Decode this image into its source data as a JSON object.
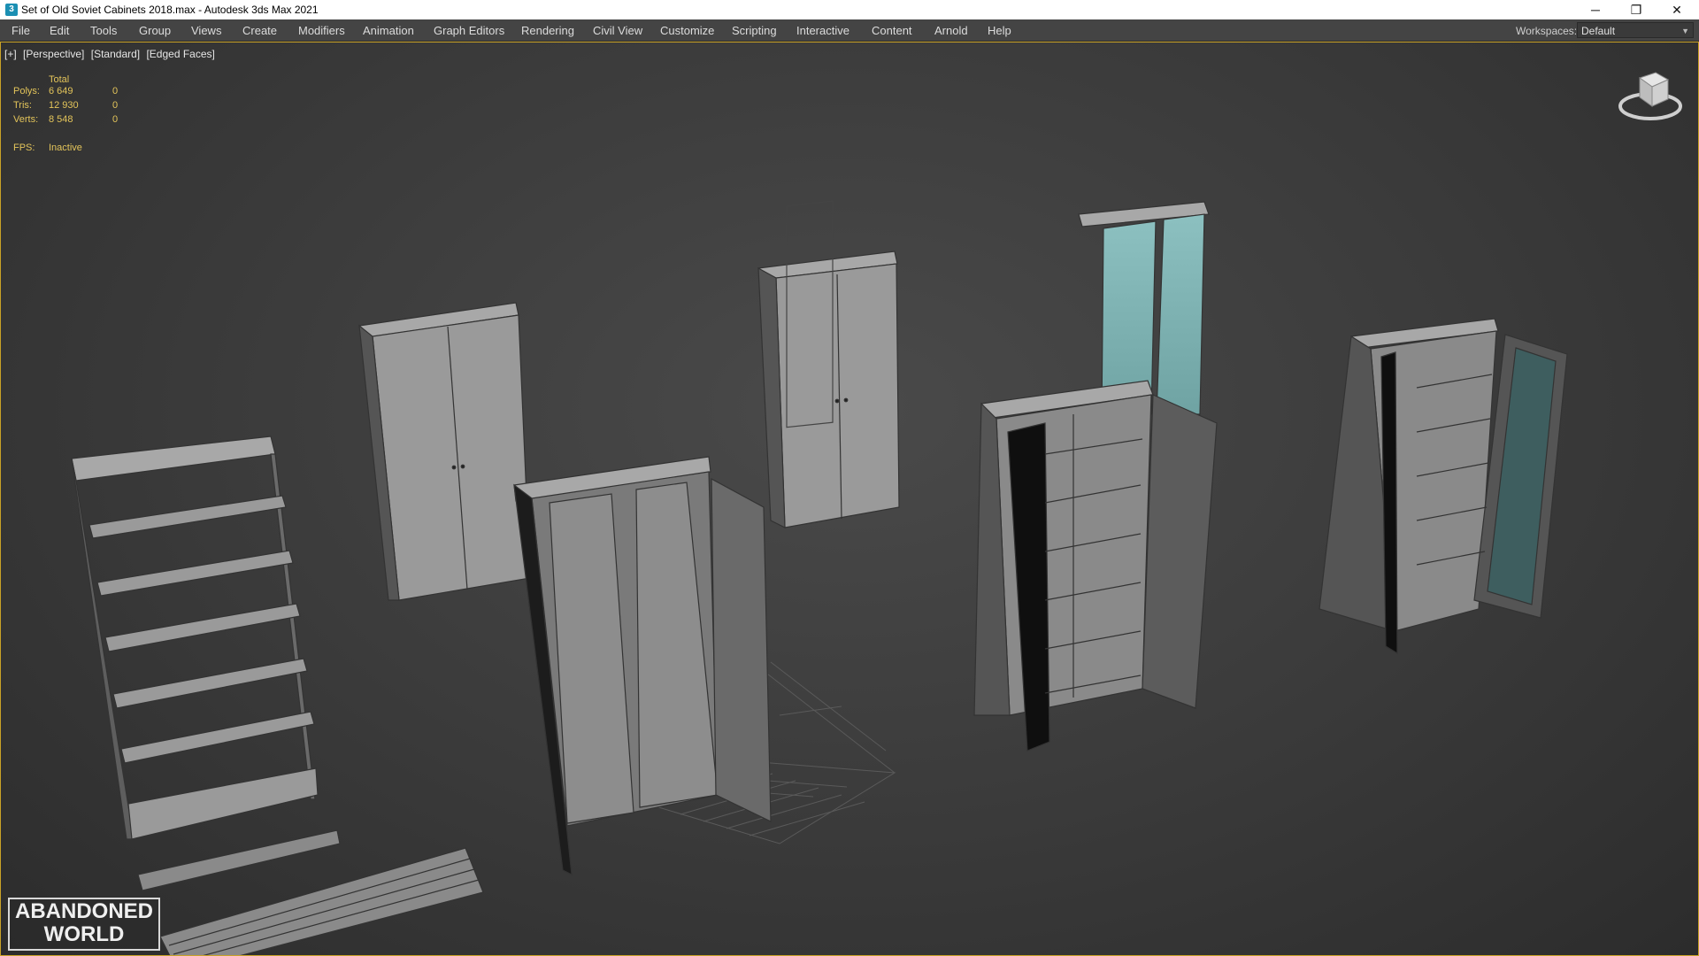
{
  "window": {
    "title": "Set of Old Soviet Cabinets 2018.max - Autodesk 3ds Max 2021",
    "app_icon": "3ds-max-icon",
    "controls": {
      "minimize": "─",
      "restore": "❐",
      "close": "✕"
    }
  },
  "menu": {
    "items": [
      "File",
      "Edit",
      "Tools",
      "Group",
      "Views",
      "Create",
      "Modifiers",
      "Animation",
      "Graph Editors",
      "Rendering",
      "Civil View",
      "Customize",
      "Scripting",
      "Interactive",
      "Content",
      "Arnold",
      "Help"
    ],
    "workspaces_label": "Workspaces:",
    "workspaces_value": "Default"
  },
  "viewport": {
    "labels": [
      "[+]",
      "[Perspective]",
      "[Standard]",
      "[Edged Faces]"
    ],
    "stats": {
      "header": "Total",
      "rows": [
        {
          "label": "Polys:",
          "total": "6 649",
          "selected": "0"
        },
        {
          "label": "Tris:",
          "total": "12 930",
          "selected": "0"
        },
        {
          "label": "Verts:",
          "total": "8 548",
          "selected": "0"
        }
      ],
      "fps_label": "FPS:",
      "fps_value": "Inactive"
    },
    "viewcube": "viewcube-icon",
    "watermark": {
      "line1": "ABANDONED",
      "line2": "WORLD"
    }
  },
  "colors": {
    "menubar_bg": "#444444",
    "viewport_border": "#c9a227",
    "stats_text": "#e3c45a",
    "cabinet_gray": "#8e8e8e",
    "glass_light": "#7fb0b0",
    "glass_dark": "#3e5e5f"
  }
}
